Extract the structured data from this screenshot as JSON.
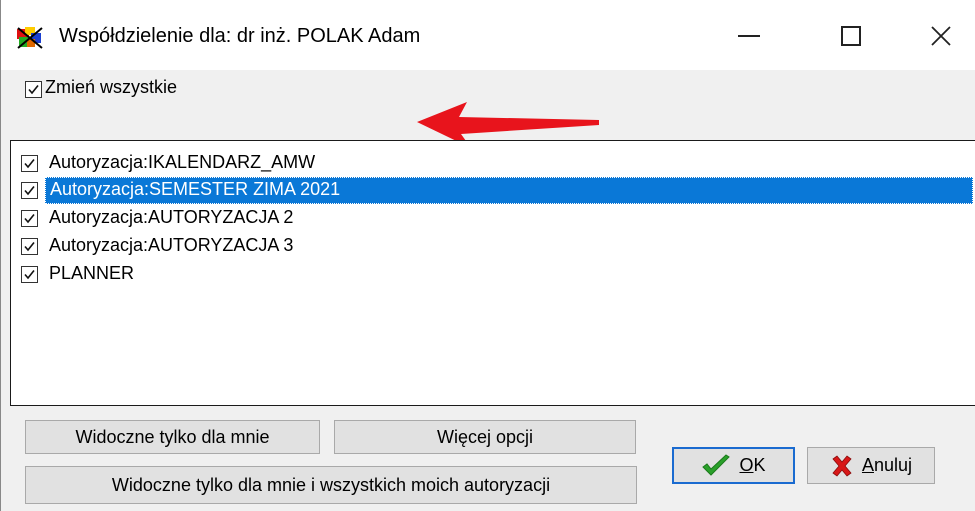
{
  "window": {
    "title": "Współdzielenie dla: dr inż. POLAK  Adam"
  },
  "change_all": {
    "label": "Zmień wszystkie",
    "checked": true
  },
  "list": {
    "items": [
      {
        "label": "Autoryzacja:IKALENDARZ_AMW",
        "checked": true,
        "selected": false
      },
      {
        "label": "Autoryzacja:SEMESTER ZIMA 2021",
        "checked": true,
        "selected": true
      },
      {
        "label": "Autoryzacja:AUTORYZACJA 2",
        "checked": true,
        "selected": false
      },
      {
        "label": "Autoryzacja:AUTORYZACJA 3",
        "checked": true,
        "selected": false
      },
      {
        "label": "PLANNER",
        "checked": true,
        "selected": false
      }
    ]
  },
  "buttons": {
    "visible_only_me": "Widoczne tylko dla mnie",
    "more_options": "Więcej opcji",
    "visible_me_and_auth": "Widoczne tylko dla mnie i wszystkich moich autoryzacji",
    "ok_underlined": "O",
    "ok_rest": "K",
    "cancel_underlined": "A",
    "cancel_rest": "nuluj"
  },
  "colors": {
    "selection": "#0a78d7",
    "annotation_arrow": "#e8141c",
    "ok_icon": "#2aa02a",
    "cancel_icon": "#d81818"
  },
  "icons": {
    "app": "app-icon",
    "ok": "checkmark-icon",
    "cancel": "x-icon",
    "annotation": "arrow-left-annotation"
  }
}
